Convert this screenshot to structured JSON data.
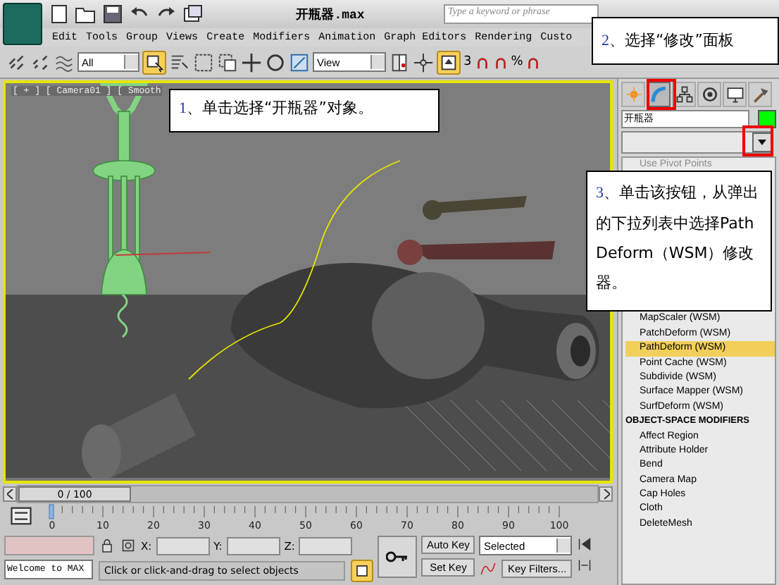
{
  "window": {
    "title": "开瓶器.max"
  },
  "search": {
    "placeholder": "Type a keyword or phrase"
  },
  "menu": [
    "Edit",
    "Tools",
    "Group",
    "Views",
    "Create",
    "Modifiers",
    "Animation",
    "Graph Editors",
    "Rendering",
    "Custo"
  ],
  "toolbar": {
    "selection_filter": "All",
    "reference_coord": "View",
    "snap_label": "3",
    "percent_label": "%"
  },
  "viewport": {
    "label": "[ + ] [ Camera01 ] [ Smooth"
  },
  "callouts": [
    {
      "kind": "viewport",
      "number": "1",
      "text": "、单击选择“开瓶器”对象。"
    },
    {
      "kind": "tab",
      "number": "2",
      "text": "、选择“修改”面板"
    },
    {
      "kind": "dropdown",
      "number": "3",
      "text": "、单击该按钮，从弹出的下拉列表中选择PathDeform（WSM）修改器。"
    }
  ],
  "command_panel": {
    "tabs": [
      {
        "kind": "create",
        "selected": false
      },
      {
        "kind": "modify",
        "selected": true
      },
      {
        "kind": "hierarchy",
        "selected": false
      },
      {
        "kind": "motion",
        "selected": false
      },
      {
        "kind": "display",
        "selected": false
      },
      {
        "kind": "utilities",
        "selected": false
      }
    ],
    "object_name": "开瓶器",
    "top_items": [
      {
        "label": "Use Pivot Points",
        "disabled": true
      }
    ],
    "items": [
      {
        "kind": "item",
        "label": "MapScaler (WSM)",
        "selected": false
      },
      {
        "kind": "item",
        "label": "PatchDeform (WSM)",
        "selected": false
      },
      {
        "kind": "item",
        "label": "PathDeform (WSM)",
        "selected": true
      },
      {
        "kind": "item",
        "label": "Point Cache (WSM)",
        "selected": false
      },
      {
        "kind": "item",
        "label": "Subdivide (WSM)",
        "selected": false
      },
      {
        "kind": "item",
        "label": "Surface Mapper (WSM)",
        "selected": false
      },
      {
        "kind": "item",
        "label": "SurfDeform (WSM)",
        "selected": false
      },
      {
        "kind": "header",
        "label": "OBJECT-SPACE MODIFIERS"
      },
      {
        "kind": "item",
        "label": "Affect Region",
        "selected": false
      },
      {
        "kind": "item",
        "label": "Attribute Holder",
        "selected": false
      },
      {
        "kind": "item",
        "label": "Bend",
        "selected": false
      },
      {
        "kind": "item",
        "label": "Camera Map",
        "selected": false
      },
      {
        "kind": "item",
        "label": "Cap Holes",
        "selected": false
      },
      {
        "kind": "item",
        "label": "Cloth",
        "selected": false
      },
      {
        "kind": "item",
        "label": "DeleteMesh",
        "selected": false
      }
    ]
  },
  "time_slider": {
    "label": "0 / 100",
    "level": 0
  },
  "ruler_labels": [
    "0",
    "10",
    "20",
    "30",
    "40",
    "50",
    "60",
    "70",
    "80",
    "90",
    "100"
  ],
  "status": {
    "script_output": "Welcome to MAX",
    "x_label": "X:",
    "y_label": "Y:",
    "z_label": "Z:",
    "prompt": "Click or click-and-drag to select objects"
  },
  "animation": {
    "auto_key": "Auto Key",
    "set_key": "Set Key",
    "key_mode": "Selected",
    "key_filters": "Key Filters..."
  }
}
